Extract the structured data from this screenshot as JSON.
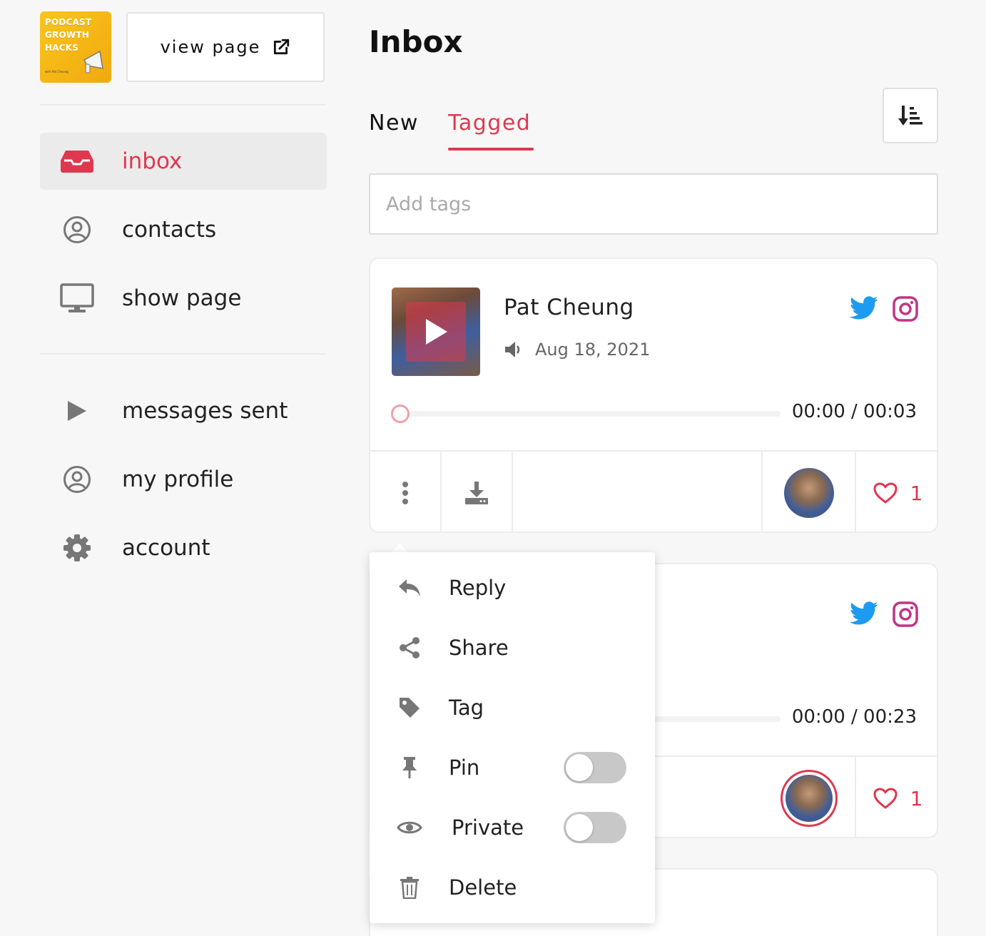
{
  "brand": {
    "logo_lines": [
      "PODCAST",
      "GROWTH",
      "HACKS"
    ],
    "logo_subtitle": "with Pat Cheung",
    "view_page_label": "view page"
  },
  "colors": {
    "accent": "#e0374f",
    "twitter": "#1d9bf0",
    "instagram": "#c13584"
  },
  "sidebar": {
    "items": [
      {
        "label": "inbox",
        "icon": "inbox-tray-icon",
        "active": true
      },
      {
        "label": "contacts",
        "icon": "user-circle-icon"
      },
      {
        "label": "show page",
        "icon": "monitor-icon"
      },
      {
        "label": "messages sent",
        "icon": "play-icon"
      },
      {
        "label": "my profile",
        "icon": "user-circle-icon"
      },
      {
        "label": "account",
        "icon": "gear-icon"
      }
    ]
  },
  "main": {
    "title": "Inbox",
    "tabs": [
      {
        "label": "New"
      },
      {
        "label": "Tagged",
        "active": true
      }
    ],
    "tags_placeholder": "Add tags",
    "cards": [
      {
        "sender": "Pat Cheung",
        "date": "Aug 18, 2021",
        "time": "00:00 / 00:03",
        "likes": "1"
      },
      {
        "sender": "",
        "date": "",
        "time": "00:00 / 00:23",
        "likes": "1"
      }
    ]
  },
  "menu": {
    "items": [
      {
        "label": "Reply",
        "icon": "reply-icon"
      },
      {
        "label": "Share",
        "icon": "share-icon"
      },
      {
        "label": "Tag",
        "icon": "tag-icon"
      },
      {
        "label": "Pin",
        "icon": "pin-icon",
        "toggle": false
      },
      {
        "label": "Private",
        "icon": "eye-icon",
        "toggle": false
      },
      {
        "label": "Delete",
        "icon": "trash-icon"
      }
    ]
  }
}
